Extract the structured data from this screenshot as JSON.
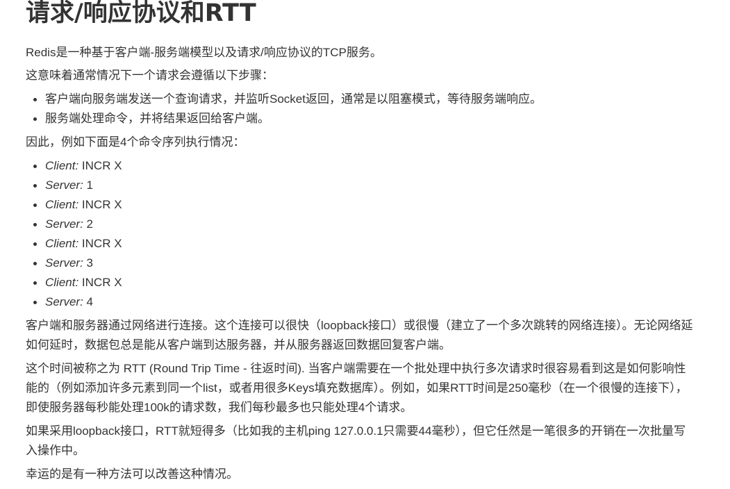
{
  "title": "请求/响应协议和RTT",
  "intro": "Redis是一种基于客户端-服务端模型以及请求/响应协议的TCP服务。",
  "steps_intro": "这意味着通常情况下一个请求会遵循以下步骤：",
  "steps": [
    "客户端向服务端发送一个查询请求，并监听Socket返回，通常是以阻塞模式，等待服务端响应。",
    "服务端处理命令，并将结果返回给客户端。"
  ],
  "sequence_intro": "因此，例如下面是4个命令序列执行情况：",
  "commands": [
    {
      "role": "Client:",
      "text": " INCR X"
    },
    {
      "role": "Server:",
      "text": " 1"
    },
    {
      "role": "Client:",
      "text": " INCR X"
    },
    {
      "role": "Server:",
      "text": " 2"
    },
    {
      "role": "Client:",
      "text": " INCR X"
    },
    {
      "role": "Server:",
      "text": " 3"
    },
    {
      "role": "Client:",
      "text": " INCR X"
    },
    {
      "role": "Server:",
      "text": " 4"
    }
  ],
  "network_paragraph": "客户端和服务器通过网络进行连接。这个连接可以很快（loopback接口）或很慢（建立了一个多次跳转的网络连接）。无论网络延如何延时，数据包总是能从客户端到达服务器，并从服务器返回数据回复客户端。",
  "rtt_paragraph": "这个时间被称之为 RTT (Round Trip Time - 往返时间). 当客户端需要在一个批处理中执行多次请求时很容易看到这是如何影响性能的（例如添加许多元素到同一个list，或者用很多Keys填充数据库）。例如，如果RTT时间是250毫秒（在一个很慢的连接下），即使服务器每秒能处理100k的请求数，我们每秒最多也只能处理4个请求。",
  "loopback_paragraph": "如果采用loopback接口，RTT就短得多（比如我的主机ping 127.0.0.1只需要44毫秒），但它任然是一笔很多的开销在一次批量写入操作中。",
  "conclusion": "幸运的是有一种方法可以改善这种情况。"
}
